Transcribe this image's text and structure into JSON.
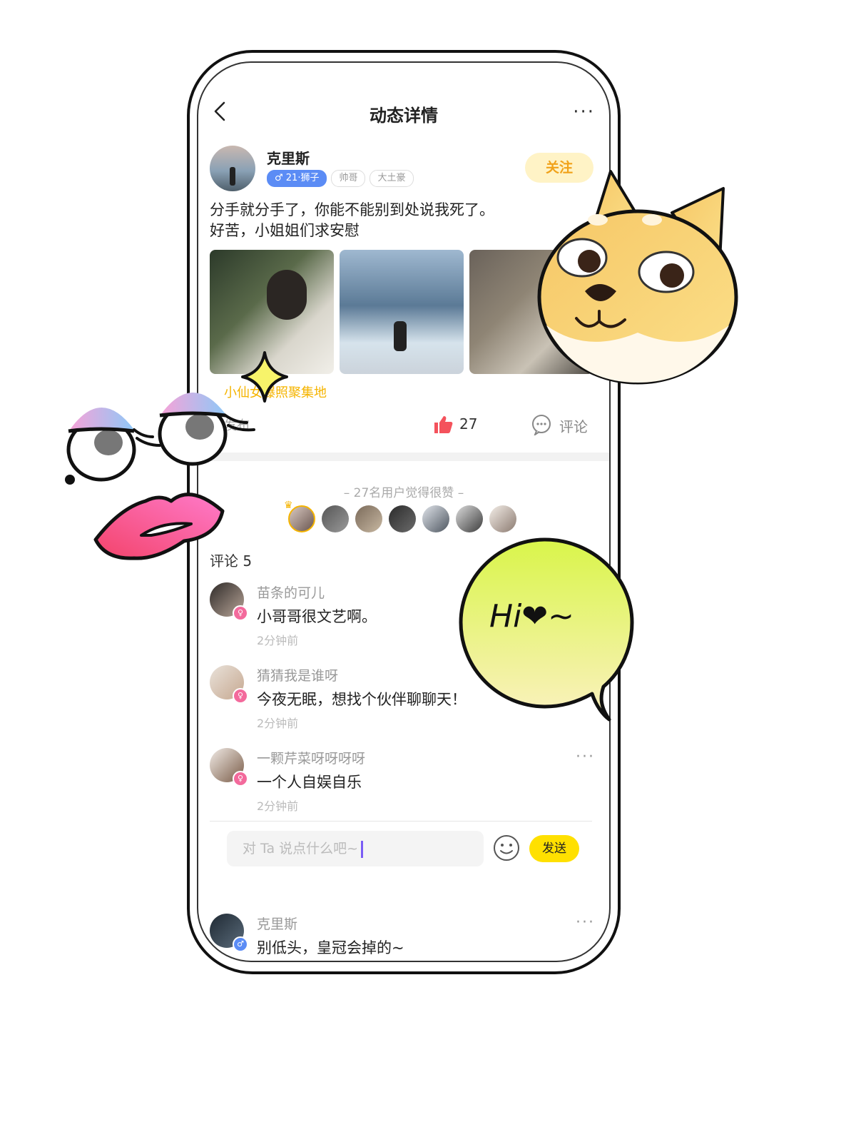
{
  "nav": {
    "title": "动态详情",
    "back_icon": "chevron-left-icon",
    "more_icon": "more-dots-icon",
    "more_glyph": "···"
  },
  "post": {
    "author": "克里斯",
    "tags": [
      "♂ 21·狮子",
      "帅哥",
      "大土豪"
    ],
    "follow_label": "关注",
    "text_line1": "分手就分手了，你能不能别到处说我死了。",
    "text_line2": "好苦，小姐姐们求安慰",
    "topic": "小仙女爆照聚集地",
    "from_partial": "发布",
    "like_count": "27",
    "comment_label": "评论"
  },
  "likes": {
    "title": "– 27名用户觉得很赞 –",
    "avatar_count": 7
  },
  "comments_section": {
    "label": "评论 5"
  },
  "comments": [
    {
      "name": "苗条的可儿",
      "text": "小哥哥很文艺啊。",
      "time": "2分钟前",
      "gender": "female"
    },
    {
      "name": "猜猜我是谁呀",
      "text": "今夜无眠，想找个伙伴聊聊天！",
      "time": "2分钟前",
      "gender": "female"
    },
    {
      "name": "一颗芹菜呀呀呀呀",
      "text": "一个人自娱自乐",
      "time": "2分钟前",
      "gender": "female"
    },
    {
      "name": "克里斯",
      "text": "别低头，皇冠会掉的~",
      "time": "",
      "gender": "male"
    }
  ],
  "input": {
    "placeholder": "对 Ta 说点什么吧~",
    "send_label": "发送"
  },
  "stickers": {
    "speech_bubble_text": "Hi❤~"
  },
  "colors": {
    "accent_yellow": "#ffe000",
    "follow_bg": "#fff3c6",
    "follow_text": "#f1a21a",
    "male_blue": "#5b8cf5",
    "female_pink": "#f36a9c",
    "like_red": "#f4525c"
  }
}
